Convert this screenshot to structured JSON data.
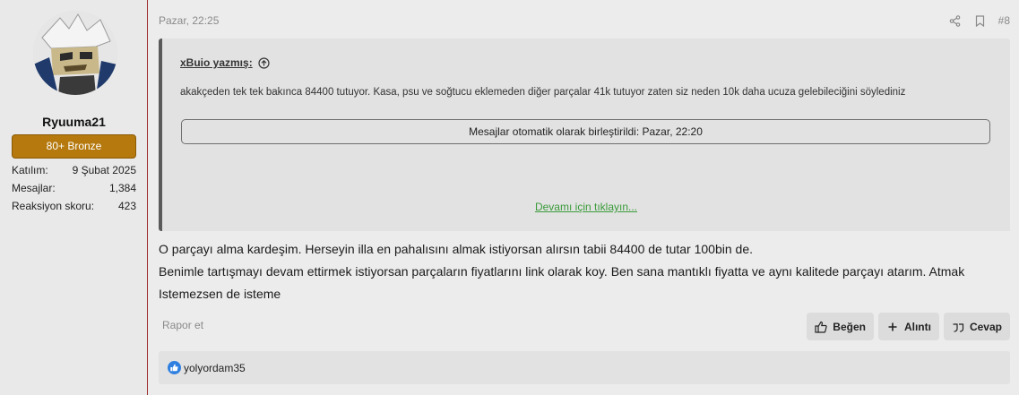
{
  "user": {
    "name": "Ryuuma21",
    "badge": "80+ Bronze",
    "stats": [
      {
        "label": "Katılım:",
        "value": "9 Şubat 2025"
      },
      {
        "label": "Mesajlar:",
        "value": "1,384"
      },
      {
        "label": "Reaksiyon skoru:",
        "value": "423"
      }
    ]
  },
  "post": {
    "date": "Pazar, 22:25",
    "number": "#8",
    "quote": {
      "author": "xBuio yazmış:",
      "text": "akakçeden tek tek bakınca 84400 tutuyor. Kasa, psu ve soğtucu eklemeden diğer parçalar 41k tutuyor zaten siz neden 10k daha ucuza gelebileciğini söylediniz",
      "merge_notice": "Mesajlar otomatik olarak birleştirildi: Pazar, 22:20",
      "expand_label": "Devamı için tıklayın..."
    },
    "body_lines": [
      "O parçayı alma kardeşim. Herseyin illa en pahalısını almak istiyorsan alırsın tabii 84400 de tutar 100bin de.",
      "Benimle tartışmayı devam ettirmek istiyorsan parçaların fiyatlarını link olarak koy. Ben sana mantıklı fiyatta ve aynı kalitede parçayı atarım. Atmak",
      "Istemezsen de isteme"
    ],
    "report_label": "Rapor et",
    "actions": {
      "like": "Beğen",
      "quote": "Alıntı",
      "reply": "Cevap"
    },
    "reaction_user": "yolyordam35"
  },
  "icons": {
    "share": "share-icon",
    "bookmark": "bookmark-icon",
    "quote_jump": "arrow-up-circle-icon",
    "like": "thumbs-up-icon",
    "plus": "plus-icon",
    "reply": "reply-quote-icon",
    "reaction": "like-reaction-icon"
  },
  "colors": {
    "badge": "#b5790e",
    "link_green": "#3a9a3a",
    "sidebar_border": "#9b2f2f",
    "reaction_blue": "#2f7fe0"
  }
}
